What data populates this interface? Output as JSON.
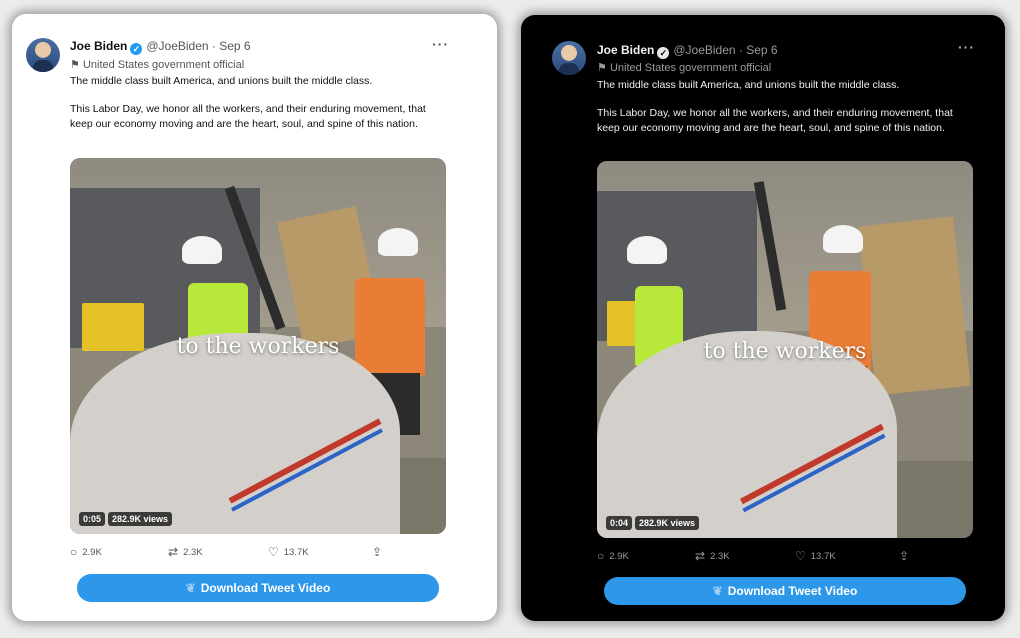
{
  "tweet": {
    "author_name": "Joe Biden",
    "handle_date": "@JoeBiden · Sep 6",
    "affiliation_label": "United States government official",
    "paragraph1": "The middle class built America, and unions built the middle class.",
    "paragraph2": "This Labor Day, we honor all the workers, and their enduring movement, that keep our economy moving and are the heart, soul, and spine of this nation.",
    "video_overlay_text": "to the workers",
    "views": "282.9K views",
    "replies": "2.9K",
    "retweets": "2.3K",
    "likes": "13.7K",
    "download_label": "Download Tweet Video"
  },
  "light_card": {
    "video_time": "0:05"
  },
  "dark_card": {
    "video_time": "0:04"
  },
  "icons": {
    "verified": "verified-badge-icon",
    "affiliation": "flag-icon",
    "more": "more-options-icon",
    "reply": "reply-icon",
    "retweet": "retweet-icon",
    "like": "heart-icon",
    "share": "share-icon",
    "download": "bird-icon"
  },
  "colors": {
    "accent": "#1d9bf0",
    "download_button": "#2d97ea",
    "light_bg": "#ffffff",
    "dark_bg": "#000000"
  }
}
